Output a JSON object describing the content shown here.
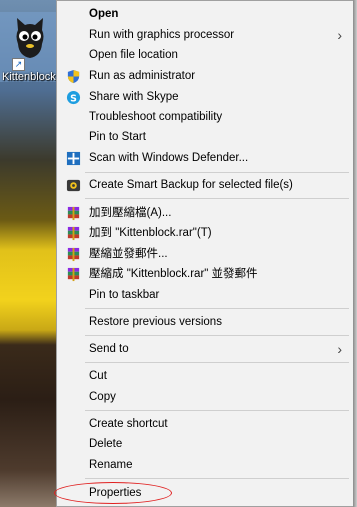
{
  "desktop": {
    "icon_label": "Kittenblock",
    "shortcut_glyph": "↗"
  },
  "menu": {
    "open": "Open",
    "run_gpu": "Run with graphics processor",
    "open_location": "Open file location",
    "run_admin": "Run as administrator",
    "share_skype": "Share with Skype",
    "troubleshoot": "Troubleshoot compatibility",
    "pin_start": "Pin to Start",
    "scan_defender": "Scan with Windows Defender...",
    "smart_backup": "Create Smart Backup for selected file(s)",
    "rar_add": "加到壓縮檔(A)...",
    "rar_add_named": "加到 \"Kittenblock.rar\"(T)",
    "rar_email": "壓縮並發郵件...",
    "rar_email_named": "壓縮成 \"Kittenblock.rar\" 並發郵件",
    "pin_taskbar": "Pin to taskbar",
    "restore_versions": "Restore previous versions",
    "send_to": "Send to",
    "cut": "Cut",
    "copy": "Copy",
    "create_shortcut": "Create shortcut",
    "delete": "Delete",
    "rename": "Rename",
    "properties": "Properties",
    "submenu_arrow": "›"
  },
  "colors": {
    "menu_bg": "#f2f2f2",
    "highlight_circle": "#e02020",
    "separator": "#cfcfcf"
  },
  "icons": {
    "run_admin": "uac-shield-icon",
    "share_skype": "skype-icon",
    "scan_defender": "defender-icon",
    "smart_backup": "backup-icon",
    "rar": "winrar-icon"
  }
}
